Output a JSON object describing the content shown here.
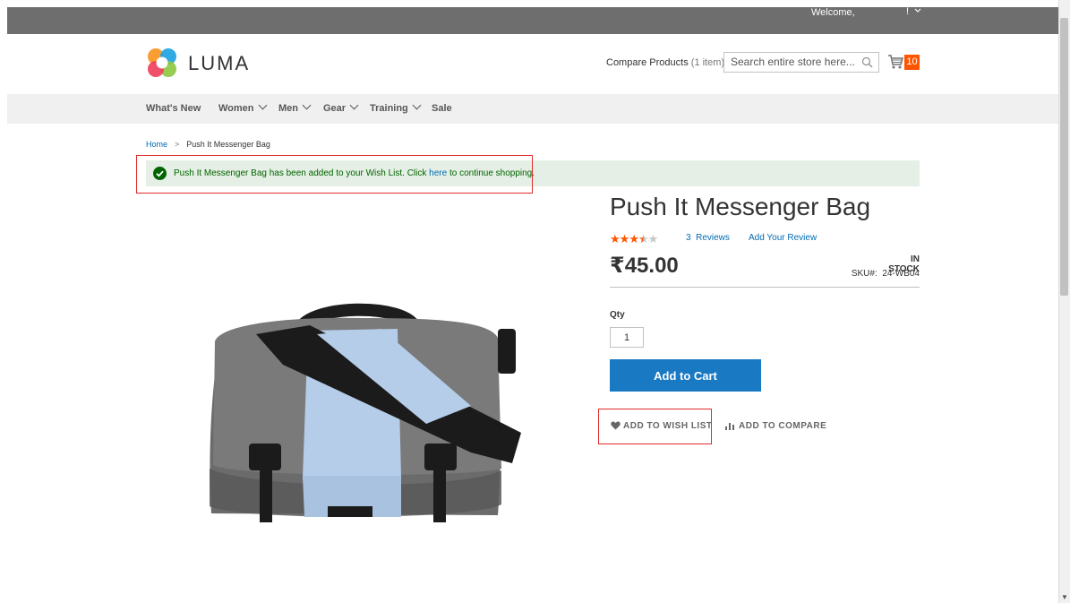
{
  "header": {
    "welcome_text": "Welcome,",
    "welcome_name": "!",
    "logo_text": "LUMA",
    "compare_products_label": "Compare Products",
    "compare_products_count": "(1 item)",
    "search_placeholder": "Search entire store here...",
    "cart_count": "10"
  },
  "nav": {
    "items": [
      {
        "label": "What's New",
        "has_dropdown": false
      },
      {
        "label": "Women",
        "has_dropdown": true
      },
      {
        "label": "Men",
        "has_dropdown": true
      },
      {
        "label": "Gear",
        "has_dropdown": true
      },
      {
        "label": "Training",
        "has_dropdown": true
      },
      {
        "label": "Sale",
        "has_dropdown": false
      }
    ]
  },
  "breadcrumb": {
    "home": "Home",
    "separator": ">",
    "current": "Push It Messenger Bag"
  },
  "message": {
    "text_before": "Push It Messenger Bag has been added to your Wish List. Click ",
    "link_text": "here",
    "text_after": " to continue shopping."
  },
  "product": {
    "title": "Push It Messenger Bag",
    "rating_stars_filled": 3.5,
    "rating_stars_total": 5,
    "reviews_link": "3  Reviews",
    "add_review_link": "Add Your Review",
    "price": "₹45.00",
    "stock_status": "IN STOCK",
    "sku_label": "SKU#:",
    "sku_value": "24-WB04",
    "qty_label": "Qty",
    "qty_value": "1",
    "add_to_cart_label": "Add to Cart",
    "add_to_wishlist_label": "ADD TO WISH LIST",
    "add_to_compare_label": "ADD TO COMPARE"
  },
  "colors": {
    "topbar": "#6e6e6e",
    "nav_bg": "#f0f0f0",
    "link": "#006bb4",
    "primary_button": "#1979c3",
    "cart_badge": "#ff5501",
    "success_bg": "#e5efe5",
    "success_text": "#006400",
    "star": "#ff5501",
    "highlight": "#e02b2b"
  },
  "icons": [
    "luma-logo-icon",
    "search-icon",
    "cart-icon",
    "chevron-down-icon",
    "checkmark-circle-icon",
    "star-icon",
    "heart-icon",
    "bar-chart-icon"
  ]
}
